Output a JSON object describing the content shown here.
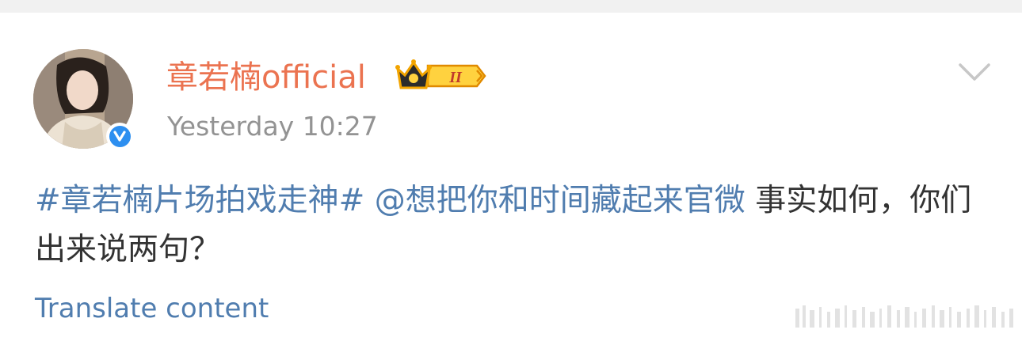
{
  "post": {
    "author": {
      "name": "章若楠official",
      "avatar_icon": "profile-photo",
      "verified_icon": "verified-badge-icon",
      "verified_badge_text": "V",
      "membership_badge_icon": "crown-membership-icon",
      "membership_badge_text": "II",
      "name_color": "#eb7350"
    },
    "timestamp": "Yesterday 10:27",
    "options_icon": "chevron-down-icon",
    "content": {
      "hashtag": "#章若楠片场拍戏走神#",
      "mention": "@想把你和时间藏起来官微",
      "text": "事实如何，你们出来说两句？",
      "link_color": "#507daf"
    },
    "translate_label": "Translate content"
  }
}
